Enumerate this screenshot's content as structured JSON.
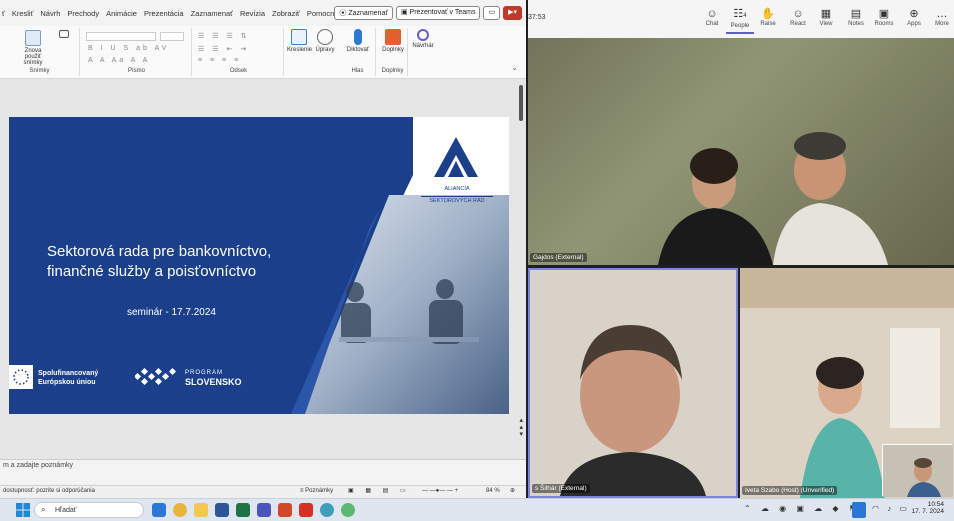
{
  "ppt": {
    "menu": [
      "ť",
      "Kresliť",
      "Návrh",
      "Prechody",
      "Animácie",
      "Prezentácia",
      "Zaznamenať",
      "Revízia",
      "Zobraziť",
      "Pomocník"
    ],
    "record_btn": "⦿ Zaznamenať",
    "present_teams_btn": "Prezentovať v Teams",
    "ribbon": {
      "new_slide": "Znova použiť snímky",
      "groups": [
        "Snímky",
        "Písmo",
        "Odsek",
        "Hlas",
        "Doplnky"
      ],
      "buttons": [
        "Kreslenie",
        "Úpravy",
        "Diktovať",
        "Doplnky",
        "Návrhár"
      ]
    },
    "slide": {
      "title_line1": "Sektorová rada pre bankovníctvo,",
      "title_line2": "finančné služby a poisťovníctvo",
      "subtitle": "seminár - 17.7.2024",
      "logo_text1": "ALIANCIA",
      "logo_text2": "SEKTOROVÝCH RÁD",
      "eu_line1": "Spolufinancovaný",
      "eu_line2": "Európskou úniou",
      "program_line1": "PROGRAM",
      "program_line2": "SLOVENSKO"
    },
    "notes_placeholder": "m a zadajte poznámky",
    "status": {
      "accessibility": "dostupnosť: pozrite si odporúčania",
      "notes_btn": "Poznámky",
      "zoom": "84 %"
    }
  },
  "teams": {
    "timer": "37:53",
    "toolbar": [
      {
        "label": "Chat",
        "icon": "☺"
      },
      {
        "label": "People",
        "icon": "☷"
      },
      {
        "label": "Raise",
        "icon": "✋"
      },
      {
        "label": "React",
        "icon": "☺"
      },
      {
        "label": "View",
        "icon": "▦"
      },
      {
        "label": "Notes",
        "icon": "▤"
      },
      {
        "label": "Rooms",
        "icon": "▣"
      },
      {
        "label": "Apps",
        "icon": "⊕"
      },
      {
        "label": "More",
        "icon": "…"
      }
    ],
    "people_count": "4",
    "participants": [
      {
        "name": "Gajdos (External)"
      },
      {
        "name": "s Šilhár (External)"
      },
      {
        "name": "Iveta Szabo (Host) (Unverified)"
      }
    ]
  },
  "taskbar": {
    "search_placeholder": "Hľadať",
    "time": "10:54",
    "date": "17. 7. 2024"
  },
  "colors": {
    "slide_blue": "#1c3f8c",
    "accent_red": "#c0392b"
  }
}
